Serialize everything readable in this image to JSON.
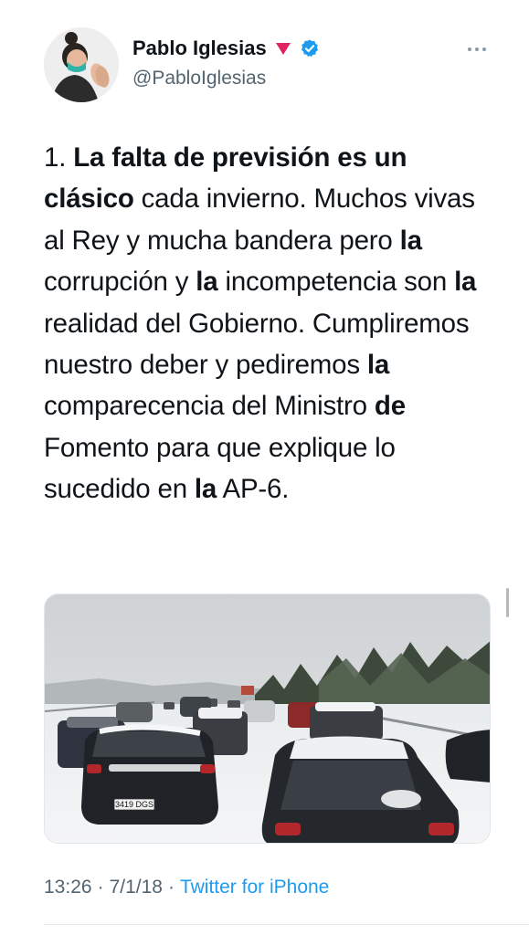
{
  "author": {
    "display_name": "Pablo Iglesias",
    "handle": "@PabloIglesias",
    "badge_icons": [
      "red-triangle-flag-icon",
      "verified-badge-icon"
    ],
    "colors": {
      "verified": "#1d9bf0",
      "flag": "#e0245e"
    }
  },
  "tweet": {
    "segments": [
      {
        "text": "1. ",
        "bold": false
      },
      {
        "text": "La falta de previsión es un clásico",
        "bold": true
      },
      {
        "text": " cada invierno. Muchos vivas al Rey y mucha bandera pero ",
        "bold": false
      },
      {
        "text": "la",
        "bold": true
      },
      {
        "text": " corrupción y ",
        "bold": false
      },
      {
        "text": "la",
        "bold": true
      },
      {
        "text": " incompetencia son ",
        "bold": false
      },
      {
        "text": "la",
        "bold": true
      },
      {
        "text": " realidad del Gobierno. Cumpliremos nuestro deber y pediremos ",
        "bold": false
      },
      {
        "text": "la",
        "bold": true
      },
      {
        "text": " comparecencia del Ministro ",
        "bold": false
      },
      {
        "text": "de",
        "bold": true
      },
      {
        "text": " Fomento para que explique lo sucedido en ",
        "bold": false
      },
      {
        "text": "la",
        "bold": true
      },
      {
        "text": " AP-6.",
        "bold": false
      }
    ],
    "license_plate": "3419 DGS"
  },
  "meta": {
    "time": "13:26",
    "separator": "·",
    "date": "7/1/18",
    "source": "Twitter for iPhone"
  },
  "colors": {
    "link": "#1d9bf0",
    "muted": "#536471",
    "text": "#0f1419"
  }
}
